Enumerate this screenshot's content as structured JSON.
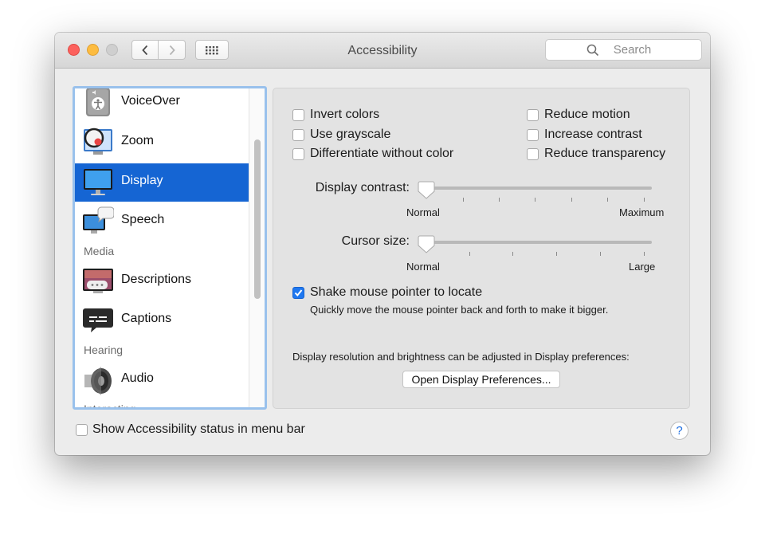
{
  "window": {
    "title": "Accessibility"
  },
  "search": {
    "placeholder": "Search"
  },
  "sidebar": {
    "items": [
      {
        "label": "VoiceOver",
        "icon": "voiceover-icon"
      },
      {
        "label": "Zoom",
        "icon": "zoom-icon"
      },
      {
        "label": "Display",
        "icon": "display-icon",
        "selected": true
      },
      {
        "label": "Speech",
        "icon": "speech-icon"
      },
      {
        "label": "Descriptions",
        "icon": "descriptions-icon"
      },
      {
        "label": "Captions",
        "icon": "captions-icon"
      },
      {
        "label": "Audio",
        "icon": "audio-icon"
      }
    ],
    "headers": [
      "Media",
      "Hearing",
      "Interacting"
    ]
  },
  "display": {
    "options_left": [
      {
        "label": "Invert colors",
        "checked": false
      },
      {
        "label": "Use grayscale",
        "checked": false
      },
      {
        "label": "Differentiate without color",
        "checked": false
      }
    ],
    "options_right": [
      {
        "label": "Reduce motion",
        "checked": false
      },
      {
        "label": "Increase contrast",
        "checked": false
      },
      {
        "label": "Reduce transparency",
        "checked": false
      }
    ],
    "contrast": {
      "label": "Display contrast:",
      "min_label": "Normal",
      "max_label": "Maximum",
      "value": 0
    },
    "cursor": {
      "label": "Cursor size:",
      "min_label": "Normal",
      "max_label": "Large",
      "value": 0
    },
    "shake": {
      "label": "Shake mouse pointer to locate",
      "checked": true,
      "description": "Quickly move the mouse pointer back and forth to make it bigger."
    },
    "resolution_note": "Display resolution and brightness can be adjusted in Display preferences:",
    "open_button": "Open Display Preferences..."
  },
  "footer": {
    "status_checkbox": {
      "label": "Show Accessibility status in menu bar",
      "checked": false
    },
    "help": "?"
  },
  "colors": {
    "selection": "#1565d3",
    "checkbox_checked": "#1f78f0",
    "focus_ring": "#99c1ec"
  }
}
